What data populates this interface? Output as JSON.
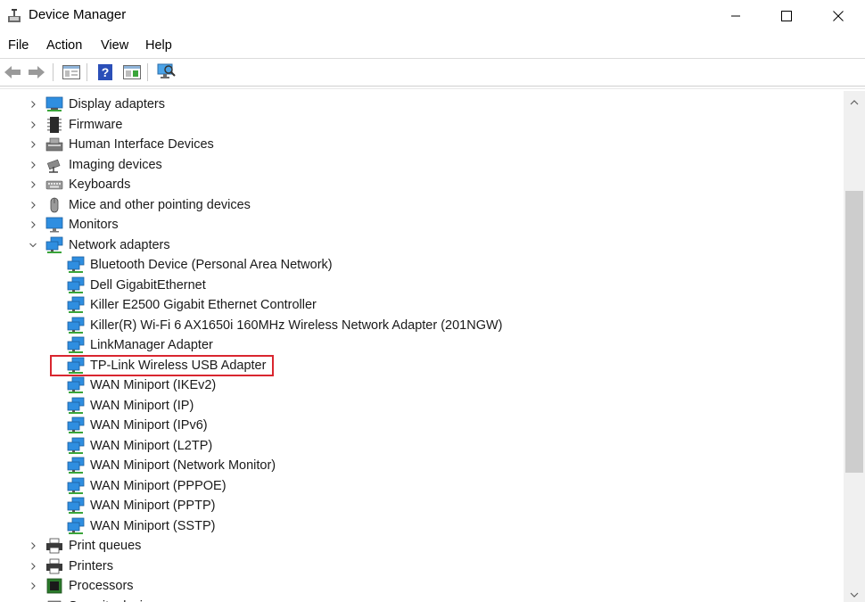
{
  "window": {
    "title": "Device Manager"
  },
  "menu": [
    "File",
    "Action",
    "View",
    "Help"
  ],
  "toolbar": [
    "back-icon",
    "forward-icon",
    "properties-icon",
    "help-icon",
    "update-driver-icon",
    "scan-hardware-icon"
  ],
  "tree": [
    {
      "label": "Display adapters",
      "icon": "display-adapter-icon",
      "level": 0,
      "expanded": false
    },
    {
      "label": "Firmware",
      "icon": "firmware-chip-icon",
      "level": 0,
      "expanded": false
    },
    {
      "label": "Human Interface Devices",
      "icon": "hid-icon",
      "level": 0,
      "expanded": false
    },
    {
      "label": "Imaging devices",
      "icon": "camera-icon",
      "level": 0,
      "expanded": false
    },
    {
      "label": "Keyboards",
      "icon": "keyboard-icon",
      "level": 0,
      "expanded": false
    },
    {
      "label": "Mice and other pointing devices",
      "icon": "mouse-icon",
      "level": 0,
      "expanded": false
    },
    {
      "label": "Monitors",
      "icon": "monitor-icon",
      "level": 0,
      "expanded": false
    },
    {
      "label": "Network adapters",
      "icon": "network-adapter-icon",
      "level": 0,
      "expanded": true
    },
    {
      "label": "Bluetooth Device (Personal Area Network)",
      "icon": "network-adapter-icon",
      "level": 1
    },
    {
      "label": "Dell GigabitEthernet",
      "icon": "network-adapter-icon",
      "level": 1
    },
    {
      "label": "Killer E2500 Gigabit Ethernet Controller",
      "icon": "network-adapter-icon",
      "level": 1
    },
    {
      "label": "Killer(R) Wi-Fi 6 AX1650i 160MHz Wireless Network Adapter (201NGW)",
      "icon": "network-adapter-icon",
      "level": 1
    },
    {
      "label": "LinkManager Adapter",
      "icon": "network-adapter-icon",
      "level": 1
    },
    {
      "label": "TP-Link Wireless USB Adapter",
      "icon": "network-adapter-icon",
      "level": 1,
      "highlighted": true
    },
    {
      "label": "WAN Miniport (IKEv2)",
      "icon": "network-adapter-icon",
      "level": 1
    },
    {
      "label": "WAN Miniport (IP)",
      "icon": "network-adapter-icon",
      "level": 1
    },
    {
      "label": "WAN Miniport (IPv6)",
      "icon": "network-adapter-icon",
      "level": 1
    },
    {
      "label": "WAN Miniport (L2TP)",
      "icon": "network-adapter-icon",
      "level": 1
    },
    {
      "label": "WAN Miniport (Network Monitor)",
      "icon": "network-adapter-icon",
      "level": 1
    },
    {
      "label": "WAN Miniport (PPPOE)",
      "icon": "network-adapter-icon",
      "level": 1
    },
    {
      "label": "WAN Miniport (PPTP)",
      "icon": "network-adapter-icon",
      "level": 1
    },
    {
      "label": "WAN Miniport (SSTP)",
      "icon": "network-adapter-icon",
      "level": 1
    },
    {
      "label": "Print queues",
      "icon": "printer-icon",
      "level": 0,
      "expanded": false
    },
    {
      "label": "Printers",
      "icon": "printer-icon",
      "level": 0,
      "expanded": false
    },
    {
      "label": "Processors",
      "icon": "processor-icon",
      "level": 0,
      "expanded": false
    },
    {
      "label": "Security devices",
      "icon": "security-icon",
      "level": 0,
      "expanded": false
    }
  ],
  "colors": {
    "highlight_border": "#d9262f",
    "adapter_blue": "#2f8ee0",
    "adapter_green": "#3aa53a"
  }
}
